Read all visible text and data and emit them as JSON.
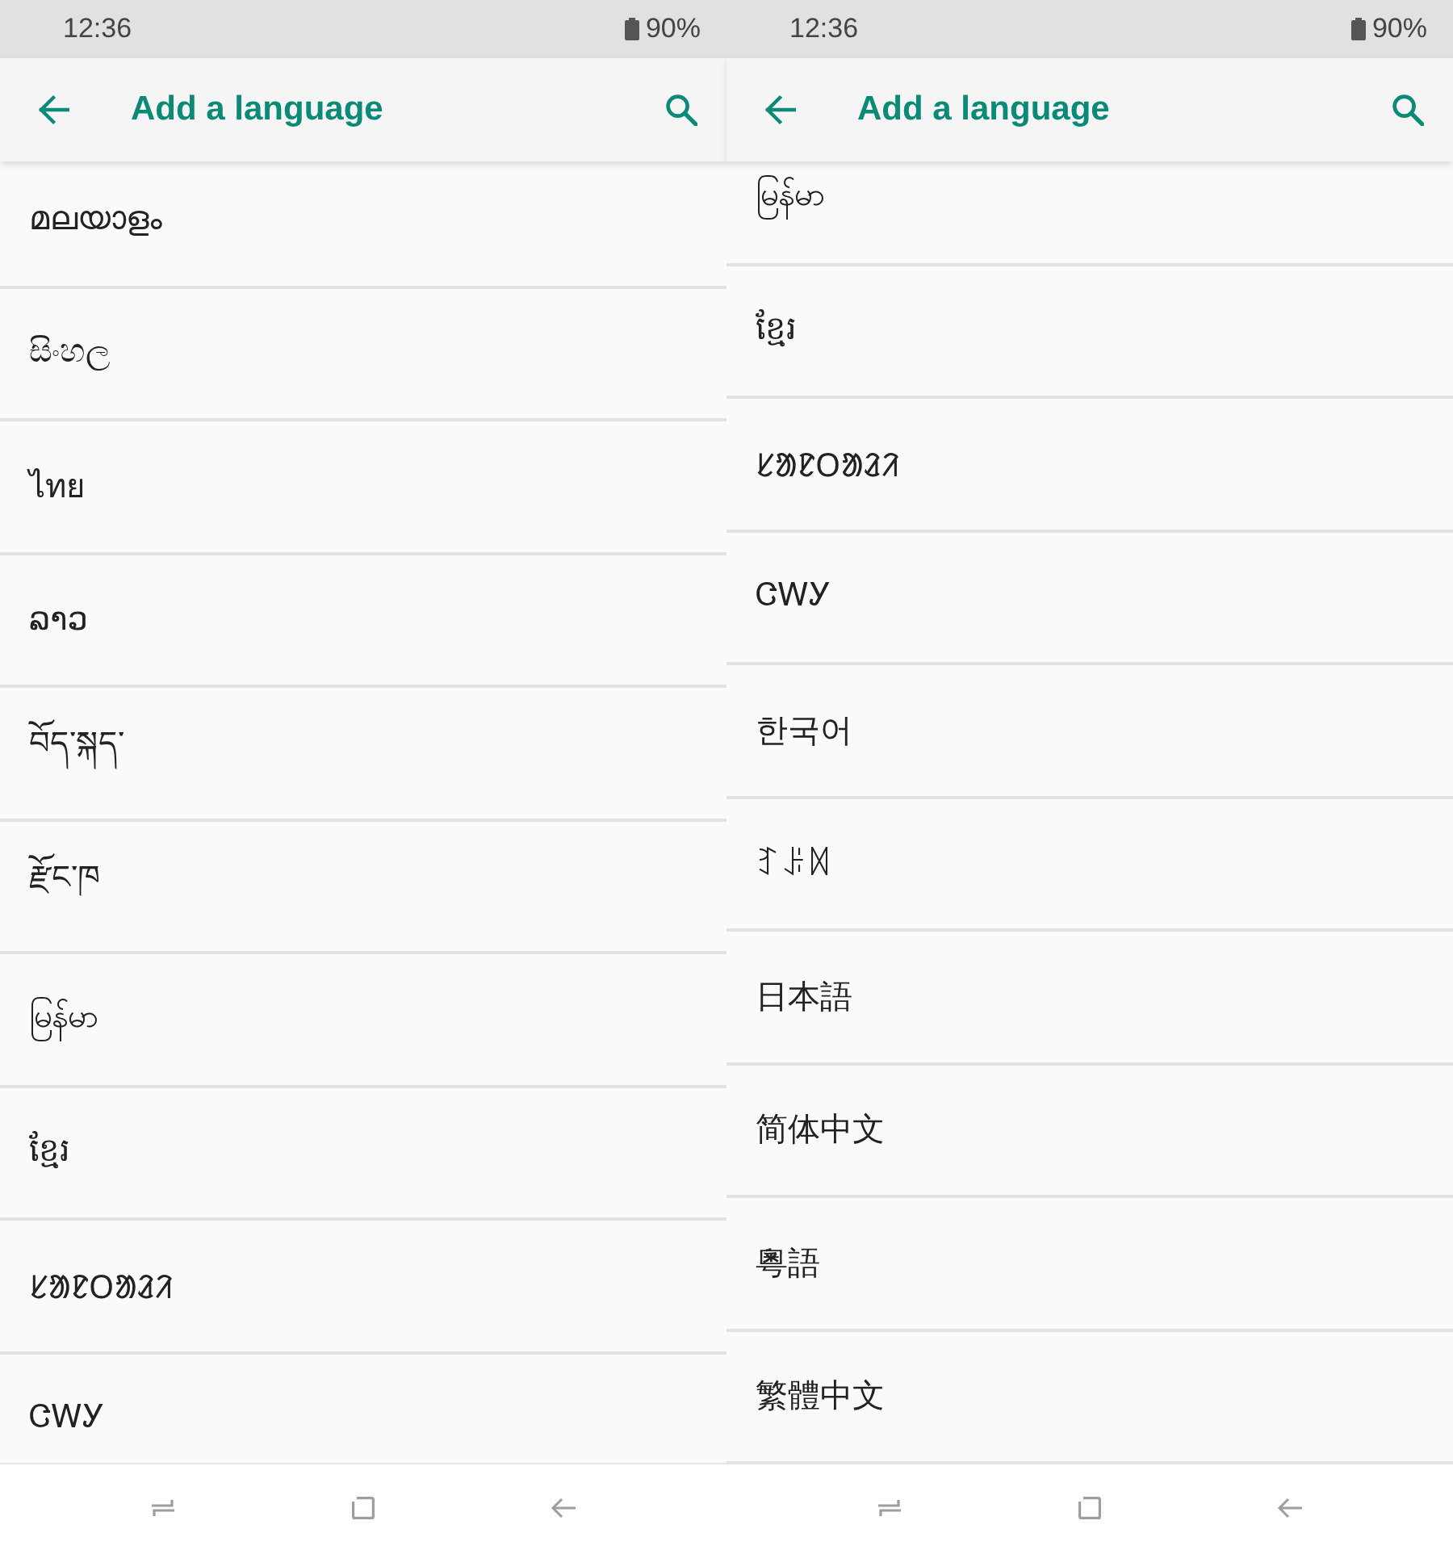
{
  "screens": [
    {
      "status_bar": {
        "time": "12:36",
        "battery": "90%"
      },
      "app_bar": {
        "title": "Add a language"
      },
      "languages": [
        {
          "name": "മലയാളം"
        },
        {
          "name": "සිංහල"
        },
        {
          "name": "ไทย"
        },
        {
          "name": "ລາວ"
        },
        {
          "name": "བོད་སྐད་"
        },
        {
          "name": "རྫོང་ཁ"
        },
        {
          "name": "မြန်မာ"
        },
        {
          "name": "ខ្មែរ"
        },
        {
          "name": "ᱥᱟᱱᱛᱟᱲᱤ"
        },
        {
          "name": "ᏣᎳᎩ"
        }
      ]
    },
    {
      "status_bar": {
        "time": "12:36",
        "battery": "90%"
      },
      "app_bar": {
        "title": "Add a language"
      },
      "languages": [
        {
          "name": "မြန်မာ"
        },
        {
          "name": "ខ្មែរ"
        },
        {
          "name": "ᱥᱟᱱᱛᱟᱲᱤ"
        },
        {
          "name": "ᏣᎳᎩ"
        },
        {
          "name": "한국어"
        },
        {
          "name": "ꆈꌠꉙ"
        },
        {
          "name": "日本語"
        },
        {
          "name": "简体中文"
        },
        {
          "name": "粵語"
        },
        {
          "name": "繁體中文"
        }
      ]
    }
  ]
}
